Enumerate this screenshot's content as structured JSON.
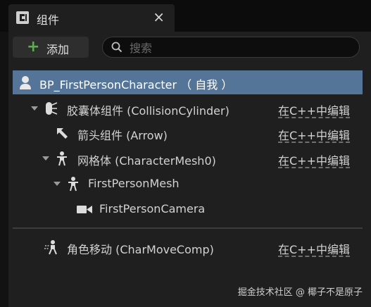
{
  "tab": {
    "title": "组件",
    "close": "×"
  },
  "toolbar": {
    "add_label": "添加",
    "search_placeholder": "搜索"
  },
  "tree": {
    "root": {
      "label": "BP_FirstPersonCharacter （ 自我 ）"
    },
    "rows": [
      {
        "label": "胶囊体组件 (CollisionCylinder)",
        "edit": "在C++中编辑"
      },
      {
        "label": "箭头组件 (Arrow)",
        "edit": "在C++中编辑"
      },
      {
        "label": "网格体 (CharacterMesh0)",
        "edit": "在C++中编辑"
      },
      {
        "label": "FirstPersonMesh",
        "edit": ""
      },
      {
        "label": "FirstPersonCamera",
        "edit": ""
      }
    ],
    "movement": {
      "label": "角色移动 (CharMoveComp)",
      "edit": "在C++中编辑"
    }
  },
  "watermark": "掘金技术社区 @ 椰子不是原子",
  "colors": {
    "selection": "#557598",
    "add_plus": "#5ab04a",
    "panel": "#1f1f1f"
  },
  "icons": [
    "blueprint-tab-icon",
    "search-icon",
    "pawn-icon",
    "capsule-icon",
    "arrow-icon",
    "skeletal-mesh-icon",
    "camera-icon",
    "movement-icon"
  ]
}
